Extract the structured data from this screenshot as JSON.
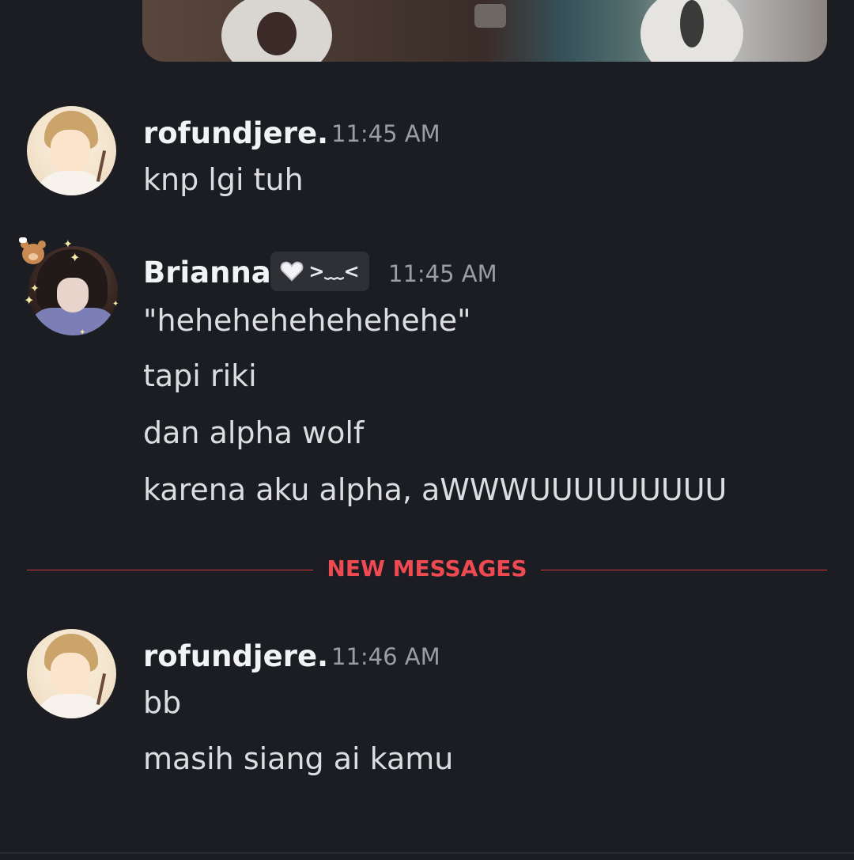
{
  "attachment": {
    "kind": "image"
  },
  "messages": [
    {
      "author": "rofundjere.",
      "time": "11:45 AM",
      "avatar": "anime-boy-avatar",
      "lines": [
        "knp lgi tuh"
      ]
    },
    {
      "author": "Brianna",
      "tag": {
        "icon": "white-heart-icon",
        "text": ">﹏<"
      },
      "time": "11:45 AM",
      "avatar": "anime-girl-avatar",
      "decoration": [
        "bear-icon",
        "sparkle-icon"
      ],
      "lines": [
        "\"hehehehehehehehe\"",
        "tapi riki",
        "dan alpha wolf",
        "karena aku alpha, aWWWUUUUUUUUU"
      ]
    },
    {
      "author": "rofundjere.",
      "time": "11:46 AM",
      "avatar": "anime-boy-avatar",
      "lines": [
        "bb",
        "masih siang ai kamu"
      ]
    }
  ],
  "divider": {
    "label": "NEW MESSAGES",
    "color": "#ef4a52"
  },
  "colors": {
    "background": "#1c1d22",
    "username": "#f2f3f5",
    "timestamp": "#9a9ca6",
    "message_text": "#dcdde1"
  }
}
